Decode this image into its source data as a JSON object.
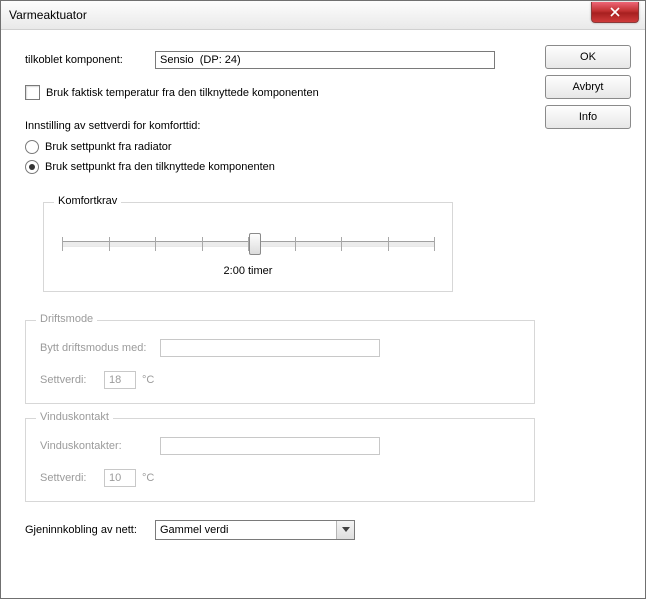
{
  "window": {
    "title": "Varmeaktuator"
  },
  "buttons": {
    "ok": "OK",
    "cancel": "Avbryt",
    "info": "Info"
  },
  "form": {
    "tilkoblet_label": "tilkoblet komponent:",
    "tilkoblet_value": "Sensio  (DP: 24)",
    "use_actual_temp": "Bruk faktisk temperatur fra den tilknyttede komponenten",
    "settverdi_heading": "Innstilling av settverdi for komforttid:",
    "radio_radiator": "Bruk settpunkt fra radiator",
    "radio_component": "Bruk settpunkt fra den tilknyttede komponenten"
  },
  "komfort": {
    "title": "Komfortkrav",
    "value_label": "2:00 timer"
  },
  "drift": {
    "title": "Driftsmode",
    "swap_label": "Bytt driftsmodus med:",
    "swap_value": "",
    "set_label": "Settverdi:",
    "set_value": "18",
    "unit": "°C"
  },
  "vindu": {
    "title": "Vinduskontakt",
    "contacts_label": "Vinduskontakter:",
    "contacts_value": "",
    "set_label": "Settverdi:",
    "set_value": "10",
    "unit": "°C"
  },
  "recon": {
    "label": "Gjeninnkobling av nett:",
    "value": "Gammel verdi"
  }
}
